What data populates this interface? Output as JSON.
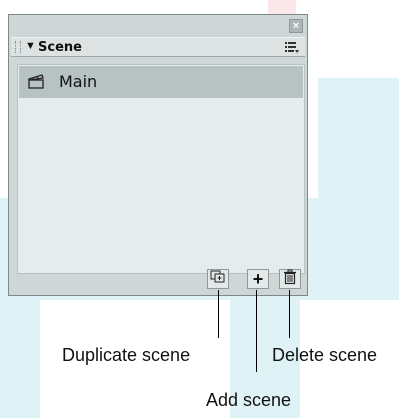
{
  "panel": {
    "title": "Scene",
    "close_glyph": "×",
    "collapse_glyph": "▼",
    "menu_glyph": "☷",
    "scenes": [
      {
        "label": "Main",
        "selected": true,
        "icon": "clapperboard-icon"
      }
    ],
    "buttons": [
      {
        "name": "duplicate-scene-button",
        "icon": "duplicate-icon"
      },
      {
        "name": "add-scene-button",
        "label": "+",
        "icon": "plus-icon"
      },
      {
        "name": "delete-scene-button",
        "icon": "trash-icon"
      }
    ]
  },
  "callouts": {
    "duplicate": "Duplicate scene",
    "add": "Add scene",
    "delete": "Delete scene"
  },
  "colors": {
    "panel_bg": "#cfd6d6",
    "selected_row": "#b7c2c3",
    "watermark_cyan": "#dff3f7",
    "watermark_red": "#fbe6ea"
  }
}
